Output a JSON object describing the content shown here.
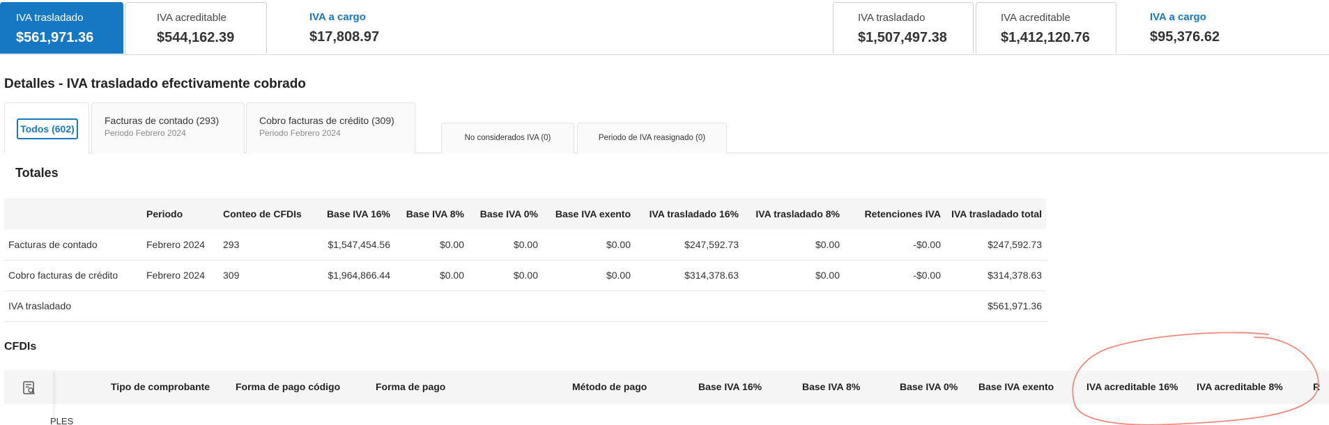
{
  "summary_left": [
    {
      "label": "IVA trasladado",
      "value": "$561,971.36"
    },
    {
      "label": "IVA acreditable",
      "value": "$544,162.39"
    },
    {
      "label": "IVA a cargo",
      "value": "$17,808.97"
    }
  ],
  "summary_right": [
    {
      "label": "IVA trasladado",
      "value": "$1,507,497.38"
    },
    {
      "label": "IVA acreditable",
      "value": "$1,412,120.76"
    },
    {
      "label": "IVA a cargo",
      "value": "$95,376.62"
    }
  ],
  "section_title": "Detalles - IVA trasladado efectivamente cobrado",
  "tabs": {
    "todos": "Todos (602)",
    "contado": {
      "title": "Facturas de contado (293)",
      "sub": "Periodo Febrero 2024"
    },
    "credito": {
      "title": "Cobro facturas de crédito (309)",
      "sub": "Periodo Febrero 2024"
    },
    "no_considerados": "No considerados IVA (0)",
    "reasignado": "Periodo de IVA reasignado (0)"
  },
  "totales_title": "Totales",
  "totals": {
    "headers": [
      "",
      "Periodo",
      "Conteo de CFDIs",
      "Base IVA 16%",
      "Base IVA 8%",
      "Base IVA 0%",
      "Base IVA exento",
      "IVA trasladado 16%",
      "IVA trasladado 8%",
      "Retenciones IVA",
      "IVA trasladado total"
    ],
    "rows": [
      [
        "Facturas de contado",
        "Febrero 2024",
        "293",
        "$1,547,454.56",
        "$0.00",
        "$0.00",
        "$0.00",
        "$247,592.73",
        "$0.00",
        "-$0.00",
        "$247,592.73"
      ],
      [
        "Cobro facturas de crédito",
        "Febrero 2024",
        "309",
        "$1,964,866.44",
        "$0.00",
        "$0.00",
        "$0.00",
        "$314,378.63",
        "$0.00",
        "-$0.00",
        "$314,378.63"
      ],
      [
        "IVA trasladado",
        "",
        "",
        "",
        "",
        "",
        "",
        "",
        "",
        "",
        "$561,971.36"
      ]
    ]
  },
  "cfdis_title": "CFDIs",
  "cfdi_headers": [
    "Tipo de comprobante",
    "Forma de pago código",
    "Forma de pago",
    "Método de pago",
    "Base IVA 16%",
    "Base IVA 8%",
    "Base IVA 0%",
    "Base IVA exento",
    "IVA acreditable 16%",
    "IVA acreditable 8%",
    "R"
  ],
  "partial_row_text": "PLES",
  "colors": {
    "accent": "#1677c3",
    "negative": "#e03b3b",
    "annotation": "#ee8a78"
  }
}
